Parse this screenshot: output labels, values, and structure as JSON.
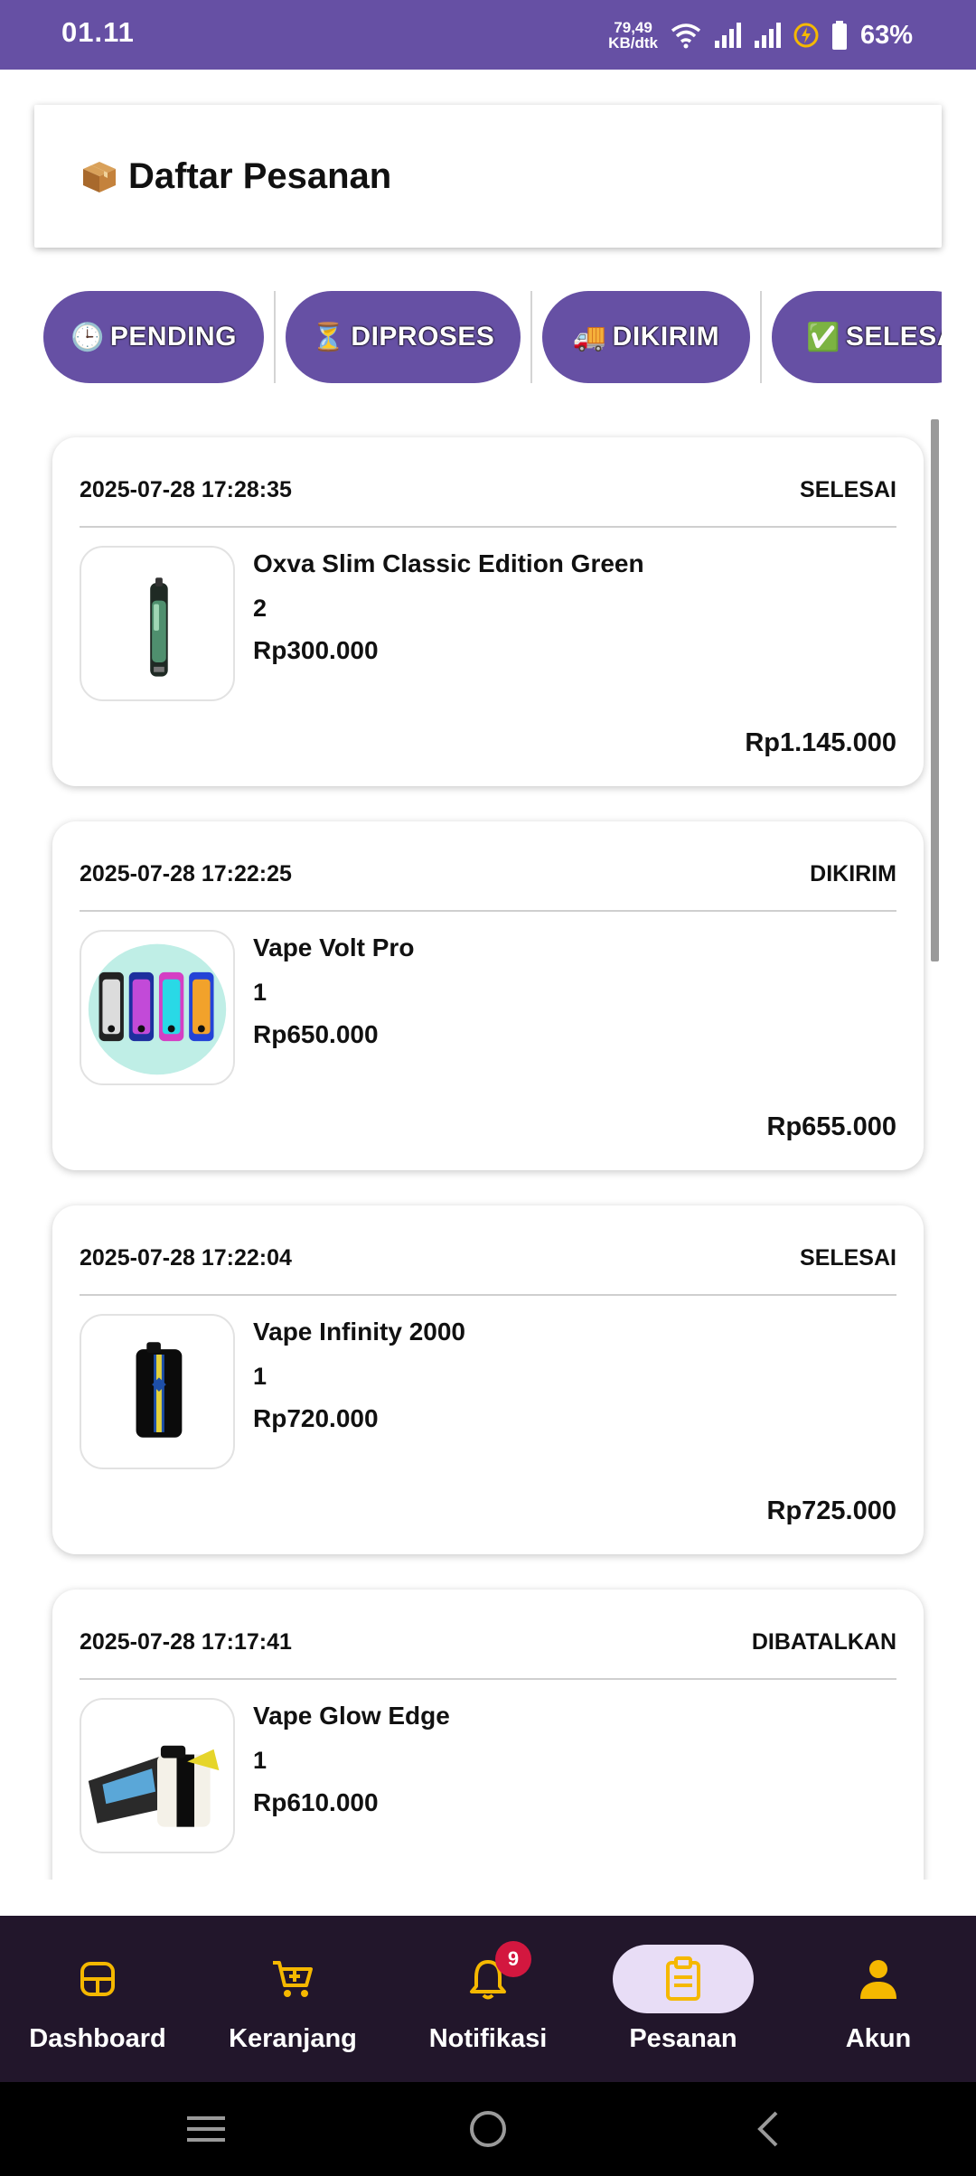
{
  "status_bar": {
    "time": "01.11",
    "net_speed_value": "79,49",
    "net_speed_unit": "KB/dtk",
    "battery": "63%"
  },
  "header": {
    "icon": "package-icon",
    "title": "Daftar Pesanan"
  },
  "tabs": [
    {
      "icon": "🕒",
      "label": "PENDING"
    },
    {
      "icon": "⏳",
      "label": "DIPROSES"
    },
    {
      "icon": "🚚",
      "label": "DIKIRIM"
    },
    {
      "icon": "✅",
      "label": "SELESAI"
    }
  ],
  "orders": [
    {
      "date": "2025-07-28 17:28:35",
      "status": "SELESAI",
      "product": "Oxva Slim Classic Edition Green",
      "qty": "2",
      "price": "Rp300.000",
      "total": "Rp1.145.000",
      "image": "pod-device-green"
    },
    {
      "date": "2025-07-28 17:22:25",
      "status": "DIKIRIM",
      "product": "Vape Volt Pro",
      "qty": "1",
      "price": "Rp650.000",
      "total": "Rp655.000",
      "image": "colorful-vapes"
    },
    {
      "date": "2025-07-28 17:22:04",
      "status": "SELESAI",
      "product": "Vape Infinity 2000",
      "qty": "1",
      "price": "Rp720.000",
      "total": "Rp725.000",
      "image": "black-blue-disposable"
    },
    {
      "date": "2025-07-28 17:17:41",
      "status": "DIBATALKAN",
      "product": "Vape Glow Edge",
      "qty": "1",
      "price": "Rp610.000",
      "total": "",
      "image": "edge-box-device"
    }
  ],
  "bottom_nav": {
    "items": [
      {
        "label": "Dashboard",
        "icon": "dashboard-icon"
      },
      {
        "label": "Keranjang",
        "icon": "cart-icon"
      },
      {
        "label": "Notifikasi",
        "icon": "bell-icon",
        "badge": "9"
      },
      {
        "label": "Pesanan",
        "icon": "clipboard-icon",
        "active": true
      },
      {
        "label": "Akun",
        "icon": "person-icon"
      }
    ]
  },
  "colors": {
    "primary": "#6650a4",
    "nav_background": "#22162b",
    "nav_icon": "#f5b800",
    "active_pill": "#e8ddf6",
    "badge": "#d3173f"
  }
}
